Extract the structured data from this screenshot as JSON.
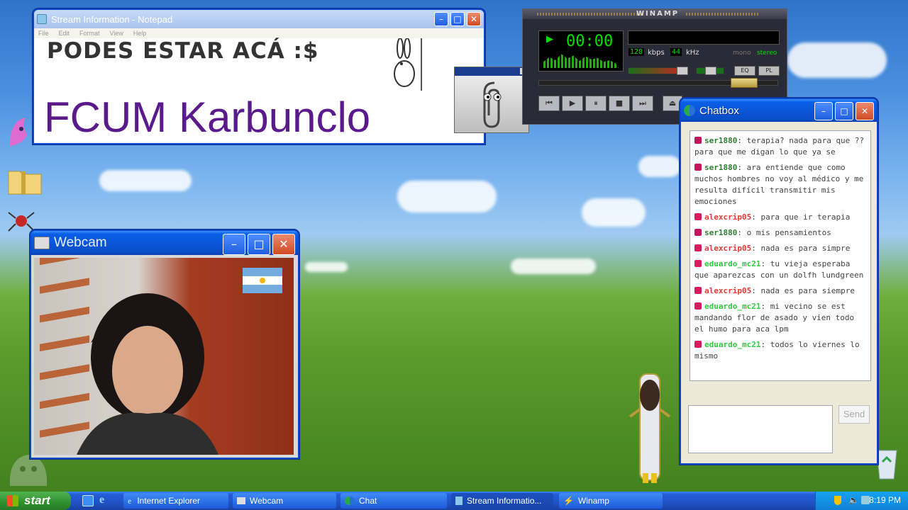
{
  "notepad": {
    "title": "Stream Information - Notepad",
    "menu": [
      "File",
      "Edit",
      "Format",
      "View",
      "Help"
    ],
    "line1": "PODES ESTAR ACÁ :$",
    "line2": "FCUM Karbunclo"
  },
  "winamp": {
    "brand": "WINAMP",
    "time": "00:00",
    "kbps_value": "128",
    "kbps_label": "kbps",
    "khz_value": "44",
    "khz_label": "kHz",
    "mono_label": "mono",
    "stereo_label": "stereo",
    "eq_label": "EQ",
    "pl_label": "PL"
  },
  "webcam": {
    "title": "Webcam"
  },
  "chatbox": {
    "title": "Chatbox",
    "send_label": "Send",
    "input_placeholder": "",
    "messages": [
      {
        "user": "ser1880",
        "text": "terapia? nada para que ?? para que me digan lo que ya se",
        "color": "#c2185b"
      },
      {
        "user": "ser1880",
        "text": "ara entiende que como muchos hombres no voy al médico y me resulta difícil transmitir mis emociones",
        "color": "#c2185b"
      },
      {
        "user": "alexcrip05",
        "text": "para que ir terapia",
        "color": "#e53935"
      },
      {
        "user": "ser1880",
        "text": "o mis pensamientos",
        "color": "#c2185b"
      },
      {
        "user": "alexcrip05",
        "text": "nada es para simpre",
        "color": "#e53935"
      },
      {
        "user": "eduardo_mc21",
        "text": "tu vieja esperaba que aparezcas con un dolfh lundgreen",
        "color": "#2ecc40"
      },
      {
        "user": "alexcrip05",
        "text": "nada es para siempre",
        "color": "#e53935"
      },
      {
        "user": "eduardo_mc21",
        "text": "mi vecino se est mandando flor de asado y vien todo el humo para aca lpm",
        "color": "#2ecc40"
      },
      {
        "user": "eduardo_mc21",
        "text": "todos lo viernes lo mismo",
        "color": "#2ecc40"
      }
    ]
  },
  "taskbar": {
    "start_label": "start",
    "buttons": [
      "Internet Explorer",
      "Webcam",
      "Chat",
      "Stream Informatio...",
      "Winamp"
    ],
    "clock": "8:19 PM"
  },
  "colors": {
    "xp_blue": "#0a56d8",
    "notepad_accent": "#5a1a8c",
    "winamp_green": "#00e000"
  }
}
